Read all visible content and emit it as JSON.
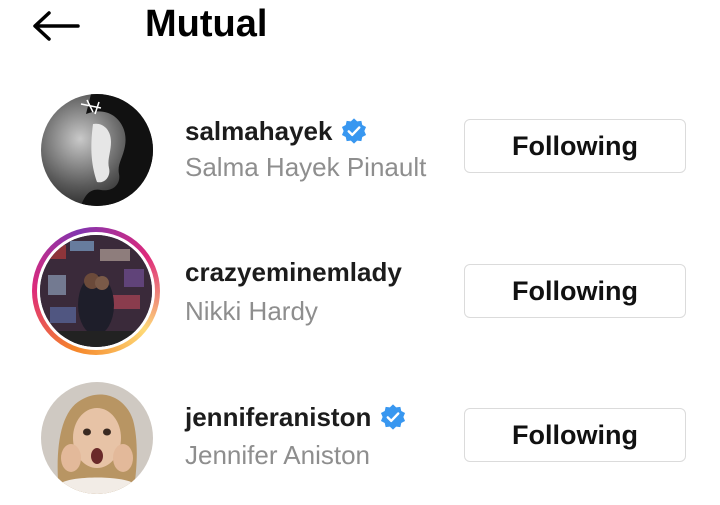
{
  "header": {
    "title": "Mutual",
    "back_icon": "arrow-left-icon"
  },
  "accounts": [
    {
      "username": "salmahayek",
      "full_name": "Salma Hayek Pinault",
      "verified": true,
      "has_story_ring": false,
      "button_label": "Following"
    },
    {
      "username": "crazyeminemlady",
      "full_name": "Nikki Hardy",
      "verified": false,
      "has_story_ring": true,
      "button_label": "Following"
    },
    {
      "username": "jenniferaniston",
      "full_name": "Jennifer Aniston",
      "verified": true,
      "has_story_ring": false,
      "button_label": "Following"
    }
  ],
  "colors": {
    "verified_blue": "#3897f0",
    "secondary_text": "#8e8e8e",
    "button_border": "#dbdbdb"
  }
}
